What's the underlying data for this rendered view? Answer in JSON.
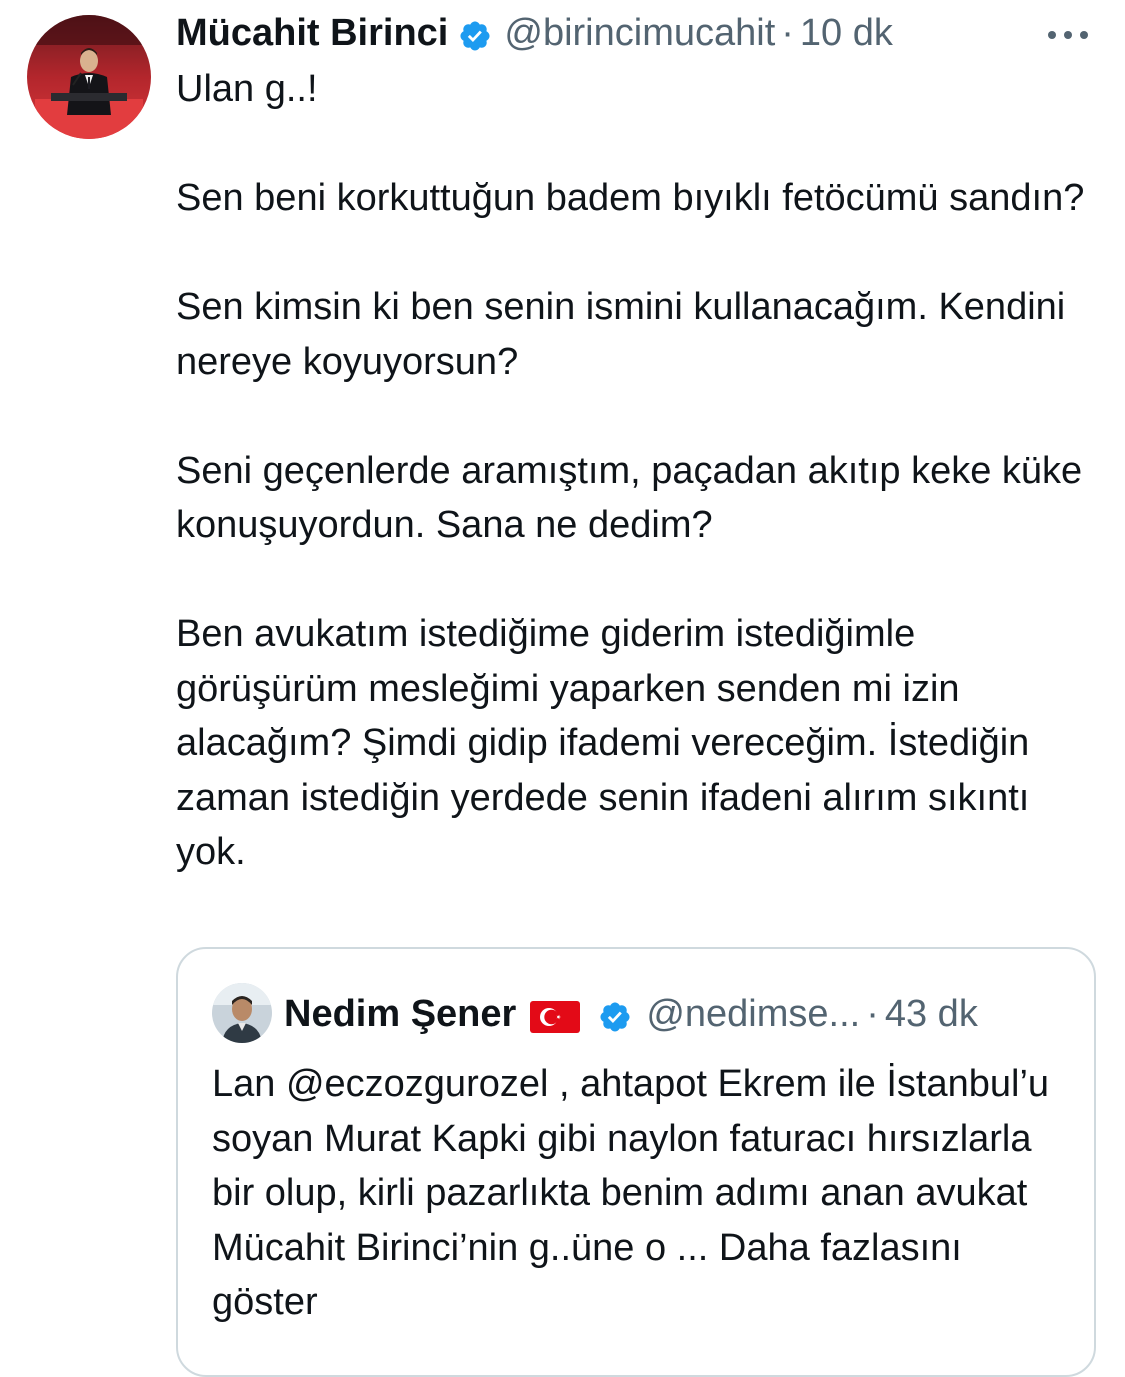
{
  "author": {
    "name": "Mücahit Birinci",
    "handle": "@birincimucahit",
    "separator": "·",
    "time": "10 dk",
    "verified": true,
    "avatar_icon": "profile-photo-speaker-at-podium"
  },
  "more_icon": "more-horizontal-icon",
  "tweet": {
    "paragraphs": [
      "Ulan g..!",
      "Sen beni korkuttuğun badem bıyıklı fetöcümü sandın?",
      "Sen kimsin ki ben senin ismini kullanacağım. Kendini nereye koyuyorsun?",
      "Seni geçenlerde aramıştım, paçadan akıtıp keke küke konuşuyordun. Sana ne dedim?",
      "Ben avukatım istediğime giderim istediğimle görüşürüm mesleğimi yaparken senden mi izin alacağım? Şimdi gidip ifademi vereceğim. İstediğin zaman istediğin yerdede senin ifadeni alırım sıkıntı yok."
    ]
  },
  "quoted": {
    "name": "Nedim Şener",
    "flag_icon": "turkey-flag-icon",
    "verified": true,
    "handle": "@nedimse...",
    "separator": "·",
    "time": "43 dk",
    "text": "Lan @eczozgurozel , ahtapot Ekrem ile İstanbul’u soyan Murat Kapki gibi naylon faturacı hırsızlarla bir olup, kirli pazarlıkta benim adımı anan avukat Mücahit Birinci’nin g..üne o ...",
    "show_more": "Daha fazlasını göster"
  },
  "colors": {
    "text": "#0f1419",
    "secondary": "#536471",
    "verified_blue": "#1d9bf0",
    "border": "#cfd9de",
    "flag_red": "#e30a17"
  }
}
